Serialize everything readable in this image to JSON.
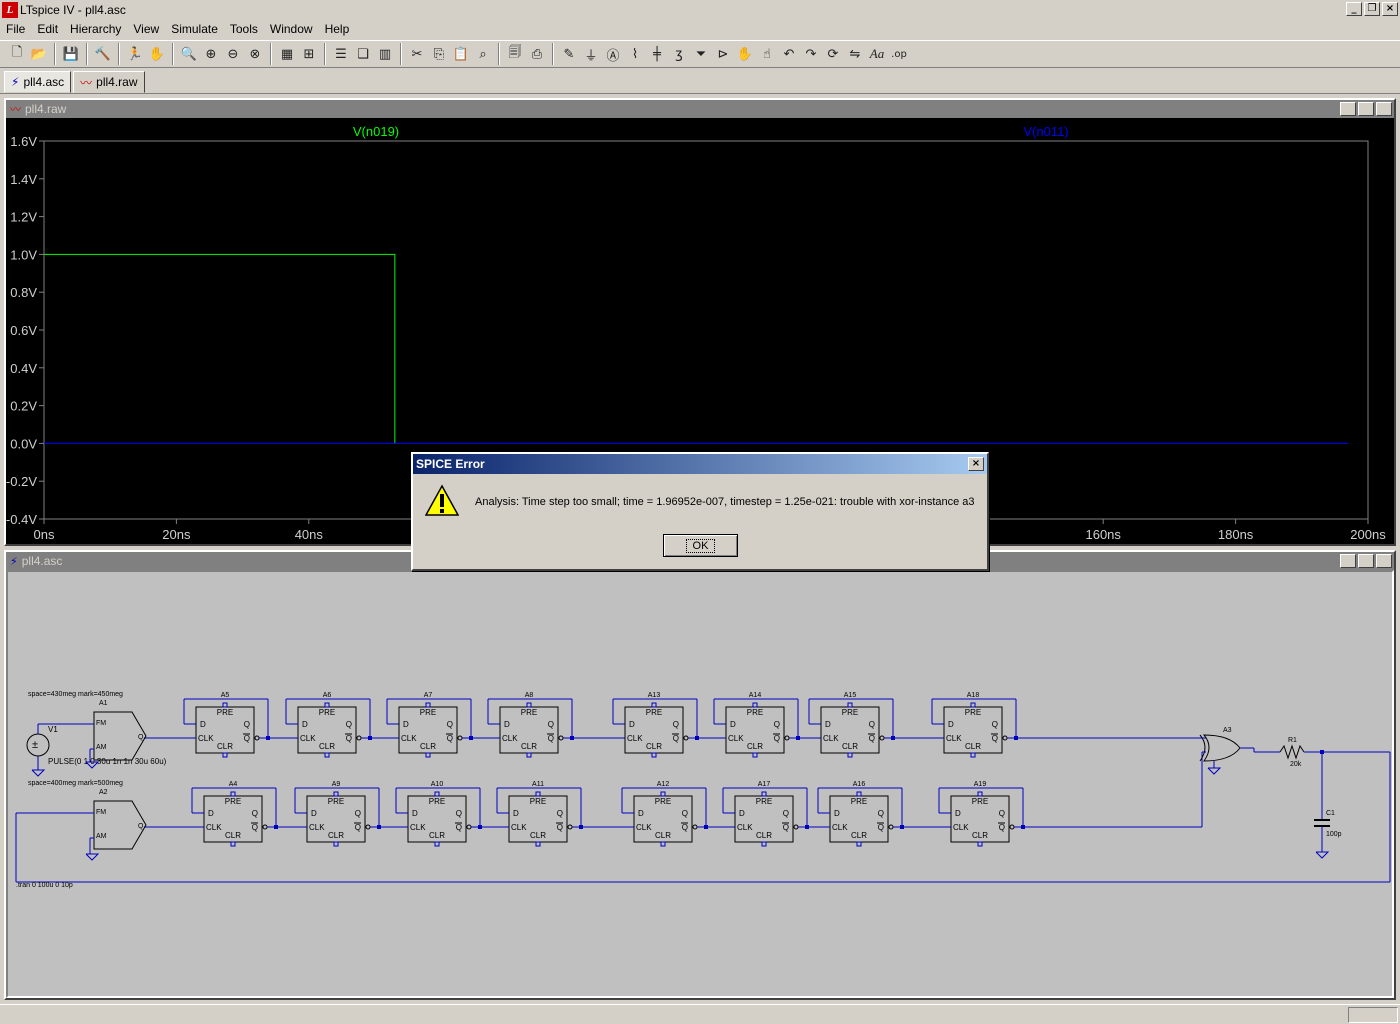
{
  "app": {
    "title": "LTspice IV - pll4.asc",
    "icon": "ltspice-logo-icon"
  },
  "menu": [
    "File",
    "Edit",
    "Hierarchy",
    "View",
    "Simulate",
    "Tools",
    "Window",
    "Help"
  ],
  "tabs": [
    {
      "label": "pll4.asc",
      "icon": "schematic-icon"
    },
    {
      "label": "pll4.raw",
      "icon": "waveform-icon"
    }
  ],
  "waveform_window": {
    "title": "pll4.raw",
    "traces": [
      {
        "name": "V(n019)",
        "color": "#00ff00"
      },
      {
        "name": "V(n011)",
        "color": "#0000ff"
      }
    ],
    "background": "#000000"
  },
  "chart_data": {
    "type": "line",
    "ylim": [
      -0.4,
      1.6
    ],
    "xlim": [
      0,
      200
    ],
    "y_ticks": [
      "1.6V",
      "1.4V",
      "1.2V",
      "1.0V",
      "0.8V",
      "0.6V",
      "0.4V",
      "0.2V",
      "0.0V",
      "-0.2V",
      "-0.4V"
    ],
    "x_ticks": [
      "0ns",
      "20ns",
      "40ns",
      "60ns",
      "80ns",
      "100ns",
      "120ns",
      "140ns",
      "160ns",
      "180ns",
      "200ns"
    ],
    "series": [
      {
        "name": "V(n019)",
        "color": "#00ff00",
        "x": [
          0,
          53,
          53
        ],
        "y": [
          1.0,
          1.0,
          0.0
        ]
      },
      {
        "name": "V(n011)",
        "color": "#0000ff",
        "x": [
          0,
          197
        ],
        "y": [
          0.0,
          0.0
        ]
      }
    ]
  },
  "schematic_window": {
    "title": "pll4.asc",
    "labels": {
      "v1": "V1",
      "a1": "A1",
      "a2": "A2",
      "a3": "A3",
      "r1": "R1",
      "r1_value": "20k",
      "c1": "C1",
      "c1_value": "100p",
      "fm1_params": "space=430meg mark=450meg",
      "fm2_params": "space=400meg mark=500meg",
      "pulse": "PULSE(0 1 0 30u 1n 1n 30u 60u)",
      "tran": ".tran 0 100u 0 10p",
      "fm": "FM",
      "am": "AM",
      "q": "Q",
      "d": "D",
      "pre": "PRE",
      "clr": "CLR",
      "clk": "CLK",
      "qbar": "Q"
    },
    "flipflops_top": [
      "A5",
      "A6",
      "A7",
      "A8",
      "A13",
      "A14",
      "A15",
      "A18"
    ],
    "flipflops_bottom": [
      "A4",
      "A9",
      "A10",
      "A11",
      "A12",
      "A17",
      "A16",
      "A19"
    ]
  },
  "dialog": {
    "title": "SPICE Error",
    "message": "Analysis:  Time step too small; time = 1.96952e-007, timestep = 1.25e-021: trouble with xor-instance a3",
    "ok_label": "OK",
    "icon": "warning-icon"
  }
}
